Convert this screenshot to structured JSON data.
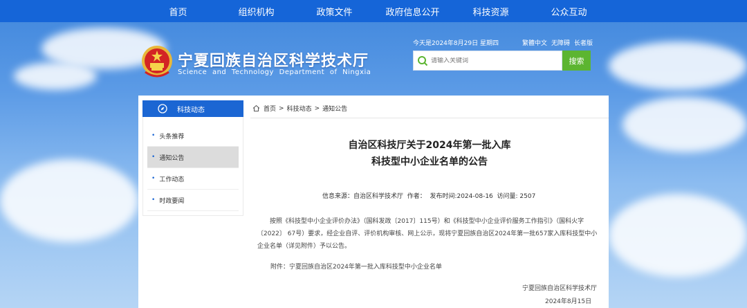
{
  "nav": {
    "items": [
      "首页",
      "组织机构",
      "政策文件",
      "政府信息公开",
      "科技资源",
      "公众互动"
    ]
  },
  "header": {
    "title_cn": "宁夏回族自治区科学技术厅",
    "title_en": "Science and Technology Department of Ningxia",
    "date": "今天是2024年8月29日 星期四",
    "links": [
      "繁體中文",
      "无障碍",
      "长者版"
    ],
    "search_placeholder": "请输入关键词",
    "search_button": "搜索"
  },
  "sidebar": {
    "heading": "科技动态",
    "items": [
      "头条推荐",
      "通知公告",
      "工作动态",
      "时政要闻"
    ],
    "active_index": 1
  },
  "breadcrumb": {
    "items": [
      "首页",
      "科技动态",
      "通知公告"
    ],
    "separator": ">"
  },
  "article": {
    "title_line1": "自治区科技厅关于2024年第一批入库",
    "title_line2": "科技型中小企业名单的公告",
    "meta": "信息来源：自治区科学技术厅  作者：  发布时间:2024-08-16  访问量: 2507",
    "body": "按照《科技型中小企业评价办法》（国科发政〔2017〕115号）和《科技型中小企业评价服务工作指引》（国科火字〔2022〕 67号）要求，经企业自评、评价机构审核、网上公示，现将宁夏回族自治区2024年第一批657家入库科技型中小企业名单（详见附件）予以公告。",
    "attachment": "附件：宁夏回族自治区2024年第一批入库科技型中小企业名单",
    "signature": "宁夏回族自治区科学技术厅",
    "sign_date": "2024年8月15日"
  },
  "colors": {
    "nav_bg": "#1565d8",
    "side_head_bg": "#1b66d3",
    "search_button_bg": "#5cb531"
  }
}
